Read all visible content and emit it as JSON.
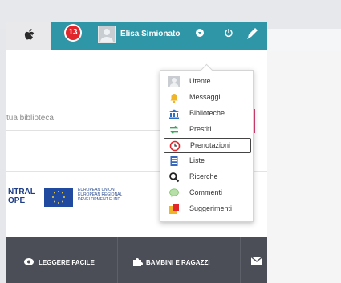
{
  "header": {
    "notification_count": "13",
    "user_name": "Elisa Simionato"
  },
  "search": {
    "placeholder_fragment": "tua biblioteca"
  },
  "user_menu": {
    "items": [
      {
        "label": "Utente",
        "icon": "user-icon"
      },
      {
        "label": "Messaggi",
        "icon": "bell-icon"
      },
      {
        "label": "Biblioteche",
        "icon": "library-icon"
      },
      {
        "label": "Prestiti",
        "icon": "transfer-icon"
      },
      {
        "label": "Prenotazioni",
        "icon": "clock-icon"
      },
      {
        "label": "Liste",
        "icon": "list-icon"
      },
      {
        "label": "Ricerche",
        "icon": "search-icon"
      },
      {
        "label": "Commenti",
        "icon": "comment-icon"
      },
      {
        "label": "Suggerimenti",
        "icon": "suggestion-icon"
      }
    ],
    "active_item": "Prenotazioni"
  },
  "sponsors": {
    "left_logo_text": "NTRAL\nOPE",
    "eu_text": [
      "EUROPEAN UNION",
      "EUROPEAN REGIONAL",
      "DEVELOPMENT FUND"
    ]
  },
  "footer": {
    "nav_items": [
      {
        "label": "LEGGERE FACILE",
        "icon": "eye-icon"
      },
      {
        "label": "BAMBINI E RAGAZZI",
        "icon": "puzzle-icon"
      }
    ],
    "mail_icon": "mail-icon"
  },
  "colors": {
    "header_teal": "#2f96a8",
    "badge_red": "#e1262c",
    "accent_pink": "#d63f72",
    "footer_dark": "#4b4e57"
  }
}
